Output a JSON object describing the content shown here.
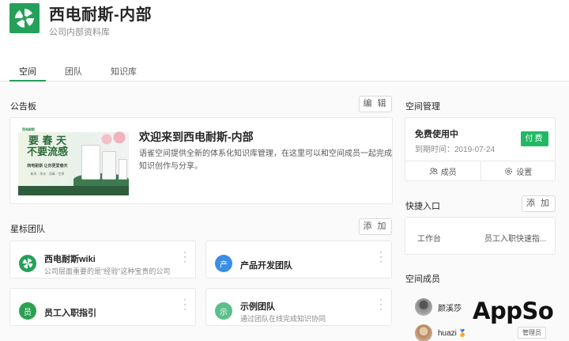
{
  "header": {
    "title": "西电耐斯-内部",
    "subtitle": "公司内部资料库",
    "tabs": [
      {
        "label": "空间",
        "active": true
      },
      {
        "label": "团队",
        "active": false
      },
      {
        "label": "知识库",
        "active": false
      }
    ]
  },
  "bulletin": {
    "section_title": "公告板",
    "edit_label": "编 辑",
    "title": "欢迎来到西电耐斯-内部",
    "text": "语雀空间提供全新的体系化知识库管理，在这里可以和空间成员一起完成知识创作与分享。",
    "banner": {
      "big_text": "要 春 天\n不要流感",
      "brand_text": "西电耐斯",
      "line1": "西电耐斯 让你更爱春天",
      "line2": "新风 · 净水 · 消毒 · 空净"
    }
  },
  "starred_teams": {
    "section_title": "星标团队",
    "add_label": "添 加",
    "teams": [
      {
        "name": "西电耐斯wiki",
        "desc": "公司层面重要的是\"经验\"这种宝贵的公司...",
        "icon": "pinwheel-icon",
        "icon_text": "",
        "color": "#25a05a"
      },
      {
        "name": "产品开发团队",
        "desc": "",
        "icon": "letter-icon",
        "icon_text": "产",
        "color": "#3a8ee6"
      },
      {
        "name": "员工入职指引",
        "desc": "",
        "icon": "letter-icon",
        "icon_text": "员",
        "color": "#2aa152"
      },
      {
        "name": "示例团队",
        "desc": "通过团队在线完成知识协同",
        "icon": "letter-icon",
        "icon_text": "示",
        "color": "#5cbf8a"
      }
    ]
  },
  "space_management": {
    "section_title": "空间管理",
    "plan": "免费使用中",
    "expire": "到期时间：2019-07-24",
    "pay_label": "付费",
    "members_label": "成员",
    "settings_label": "设置"
  },
  "quick_entry": {
    "section_title": "快捷入口",
    "add_label": "添 加",
    "items": [
      "工作台",
      "员工入职快速指..."
    ]
  },
  "space_members": {
    "section_title": "空间成员",
    "members": [
      {
        "name": "颜溪莎",
        "badge": ""
      },
      {
        "name": "huazi",
        "badge": "管理员"
      }
    ]
  },
  "watermark": "AppSo",
  "colors": {
    "accent": "#25a05a",
    "pay": "#25b864"
  }
}
